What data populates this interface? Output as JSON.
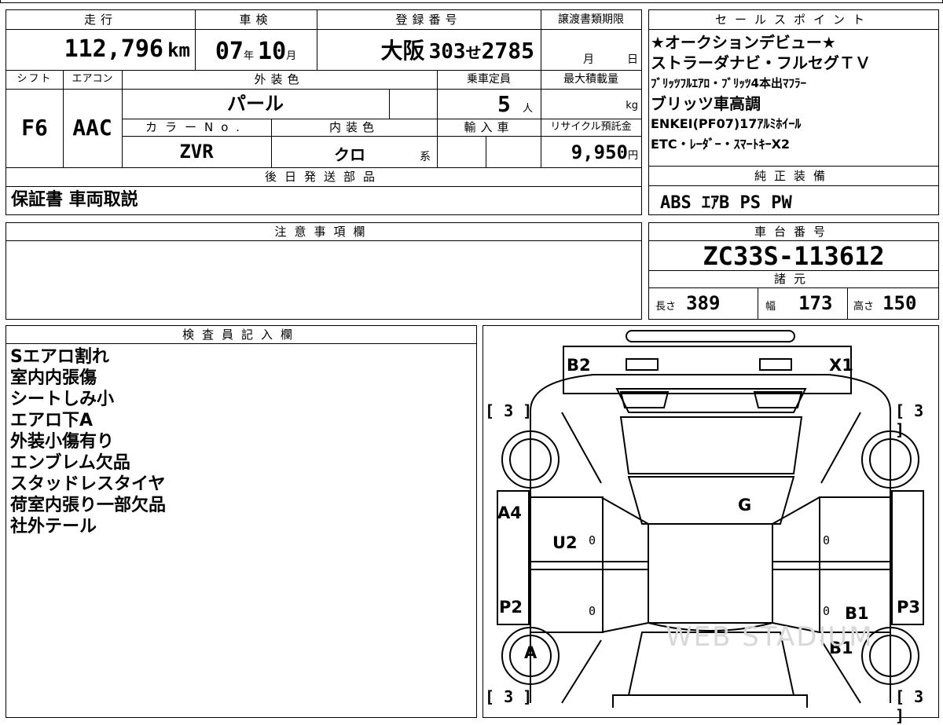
{
  "headers": {
    "mileage": "走行",
    "inspection": "車検",
    "registration": "登録番号",
    "transfer_deadline": "譲渡書類期限",
    "shift": "シフト",
    "aircon": "エアコン",
    "exterior_color": "外装色",
    "capacity": "乗車定員",
    "max_load": "最大積載量",
    "color_no": "カラーNo.",
    "interior_color": "内装色",
    "import": "輸入車",
    "recycle": "リサイクル預託金",
    "later_parts": "後日発送部品",
    "sales_points": "セールスポイント",
    "genuine_equipment": "純正装備",
    "notes": "注意事項欄",
    "chassis": "車台番号",
    "specs": "諸元",
    "inspector": "検査員記入欄"
  },
  "mileage": {
    "value": "112,796",
    "unit": "km"
  },
  "inspection": {
    "year": "07",
    "year_unit": "年",
    "month": "10",
    "month_unit": "月"
  },
  "registration": {
    "area": "大阪",
    "class": "303",
    "kana": "せ",
    "number": "2785"
  },
  "transfer_deadline": {
    "month_unit": "月",
    "day_unit": "日"
  },
  "shift": "F6",
  "aircon": "AAC",
  "exterior_color": "パール",
  "capacity": {
    "value": "5",
    "unit": "人"
  },
  "max_load": {
    "unit": "kg"
  },
  "color_no": "ZVR",
  "interior_color": {
    "value": "クロ",
    "suffix": "系"
  },
  "recycle": {
    "value": "9,950",
    "unit": "円"
  },
  "later_parts": "保証書 車両取説",
  "sales_points": [
    "★オークションデビュー★",
    "ストラーダナビ・フルセグＴＶ",
    "ﾌﾞﾘｯﾂﾌﾙｴｱﾛ・ﾌﾞﾘｯﾂ4本出ﾏﾌﾗｰ",
    "ブリッツ車高調",
    "ENKEI(PF07)17ｱﾙﾐﾎｲｰﾙ",
    "ETC・ﾚｰﾀﾞｰ・ｽﾏｰﾄｷｰX2"
  ],
  "genuine_equipment": "ABS ｴｱB PS PW",
  "chassis_number": "ZC33S-113612",
  "specs": {
    "length_label": "長さ",
    "length": "389",
    "width_label": "幅",
    "width": "173",
    "height_label": "高さ",
    "height": "150"
  },
  "inspector_notes": [
    "Sエアロ割れ",
    "室内内張傷",
    "シートしみ小",
    "エアロ下A",
    "外装小傷有り",
    "エンブレム欠品",
    "スタッドレスタイヤ",
    "荷室内張り一部欠品",
    "社外テール"
  ],
  "diagram": {
    "marks": [
      "B2",
      "X1",
      "G",
      "A4",
      "U2",
      "P2",
      "A",
      "B1",
      "B1",
      "P3"
    ],
    "tread_depth": "3",
    "zero": "0",
    "watermark": "WEB STADIUM"
  }
}
